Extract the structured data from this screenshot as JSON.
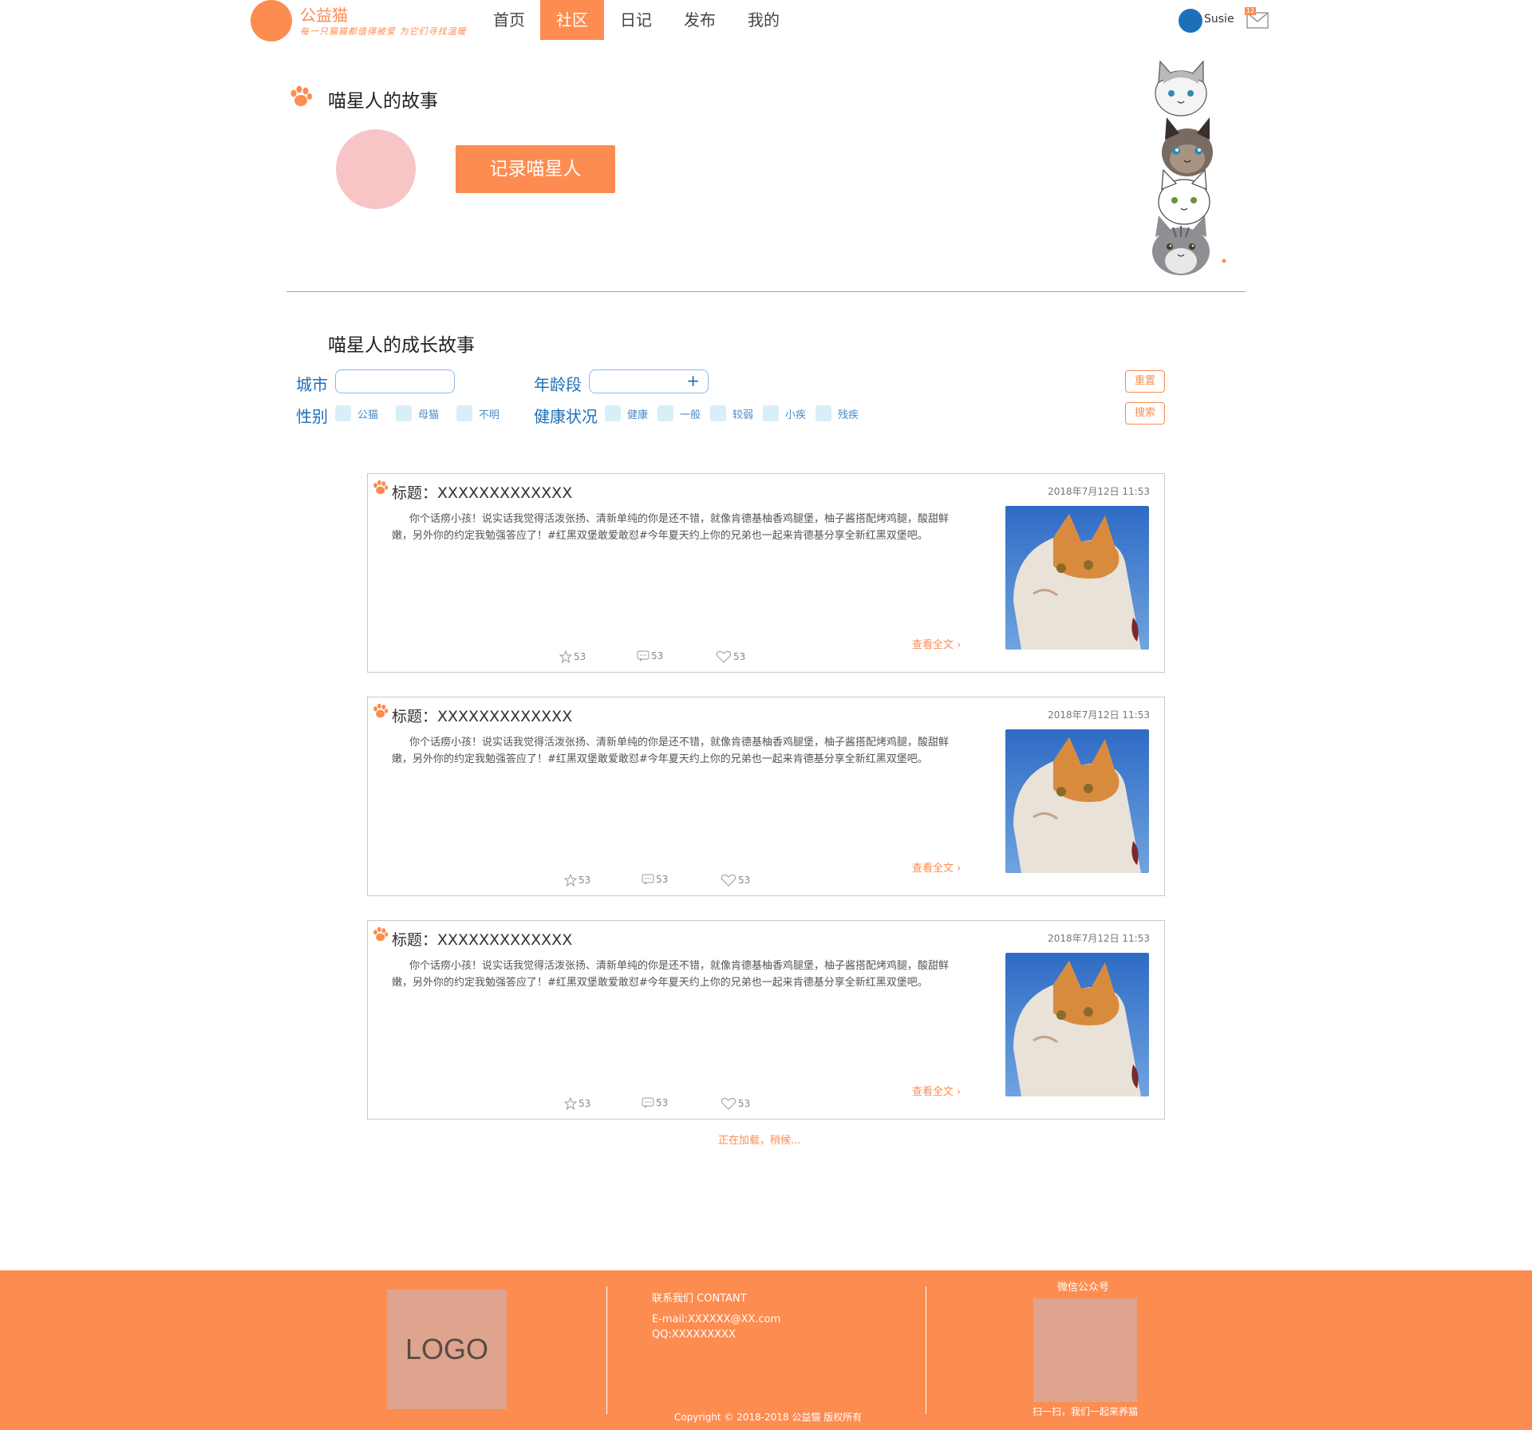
{
  "header": {
    "brand": "公益猫",
    "tagline": "每一只猫猫都值得被爱 为它们寻找温暖",
    "nav": [
      {
        "label": "首页",
        "active": false
      },
      {
        "label": "社区",
        "active": true
      },
      {
        "label": "日记",
        "active": false
      },
      {
        "label": "发布",
        "active": false
      },
      {
        "label": "我的",
        "active": false
      }
    ],
    "user_name": "Susie",
    "mail_count": "12"
  },
  "story": {
    "title": "喵星人的故事",
    "record_button": "记录喵星人"
  },
  "growth": {
    "title": "喵星人的成长故事",
    "filters": {
      "city_label": "城市",
      "city_value": "",
      "age_label": "年龄段",
      "age_plus": "+",
      "gender_label": "性别",
      "gender_options": [
        "公猫",
        "母猫",
        "不明"
      ],
      "health_label": "健康状况",
      "health_options": [
        "健康",
        "一般",
        "较弱",
        "小疾",
        "残疾"
      ],
      "reset_button": "重置",
      "search_button": "搜索"
    }
  },
  "posts": [
    {
      "title": "标题：XXXXXXXXXXXXX",
      "date": "2018年7月12日 11:53",
      "body": "你个话痨小孩！说实话我觉得活泼张扬、清新单纯的你是还不错，就像肯德基柚香鸡腿堡，柚子酱搭配烤鸡腿，酸甜鲜嫩，另外你的约定我勉强答应了！#红黑双堡敢爱敢怼#今年夏天约上你的兄弟也一起来肯德基分享全新红黑双堡吧。",
      "more": "查看全文",
      "favorites": "53",
      "comments": "53",
      "likes": "53"
    },
    {
      "title": "标题：XXXXXXXXXXXXX",
      "date": "2018年7月12日 11:53",
      "body": "你个话痨小孩！说实话我觉得活泼张扬、清新单纯的你是还不错，就像肯德基柚香鸡腿堡，柚子酱搭配烤鸡腿，酸甜鲜嫩，另外你的约定我勉强答应了！#红黑双堡敢爱敢怼#今年夏天约上你的兄弟也一起来肯德基分享全新红黑双堡吧。",
      "more": "查看全文",
      "favorites": "53",
      "comments": "53",
      "likes": "53"
    },
    {
      "title": "标题：XXXXXXXXXXXXX",
      "date": "2018年7月12日 11:53",
      "body": "你个话痨小孩！说实话我觉得活泼张扬、清新单纯的你是还不错，就像肯德基柚香鸡腿堡，柚子酱搭配烤鸡腿，酸甜鲜嫩，另外你的约定我勉强答应了！#红黑双堡敢爱敢怼#今年夏天约上你的兄弟也一起来肯德基分享全新红黑双堡吧。",
      "more": "查看全文",
      "favorites": "53",
      "comments": "53",
      "likes": "53"
    }
  ],
  "loading_text": "正在加载，稍候...",
  "footer": {
    "logo": "LOGO",
    "contact_title": "联系我们 CONTANT",
    "email": "E-mail:XXXXXX@XX.com",
    "qq": "QQ:XXXXXXXXX",
    "copyright": "Copyright © 2018-2018 公益猫 版权所有",
    "wechat_title": "微信公众号",
    "qr_caption": "扫一扫，我们一起来养猫"
  },
  "colors": {
    "accent": "#fd8c50",
    "blue": "#1d6fba",
    "pink": "#f7c5c6",
    "footer_box": "#dea48d"
  }
}
